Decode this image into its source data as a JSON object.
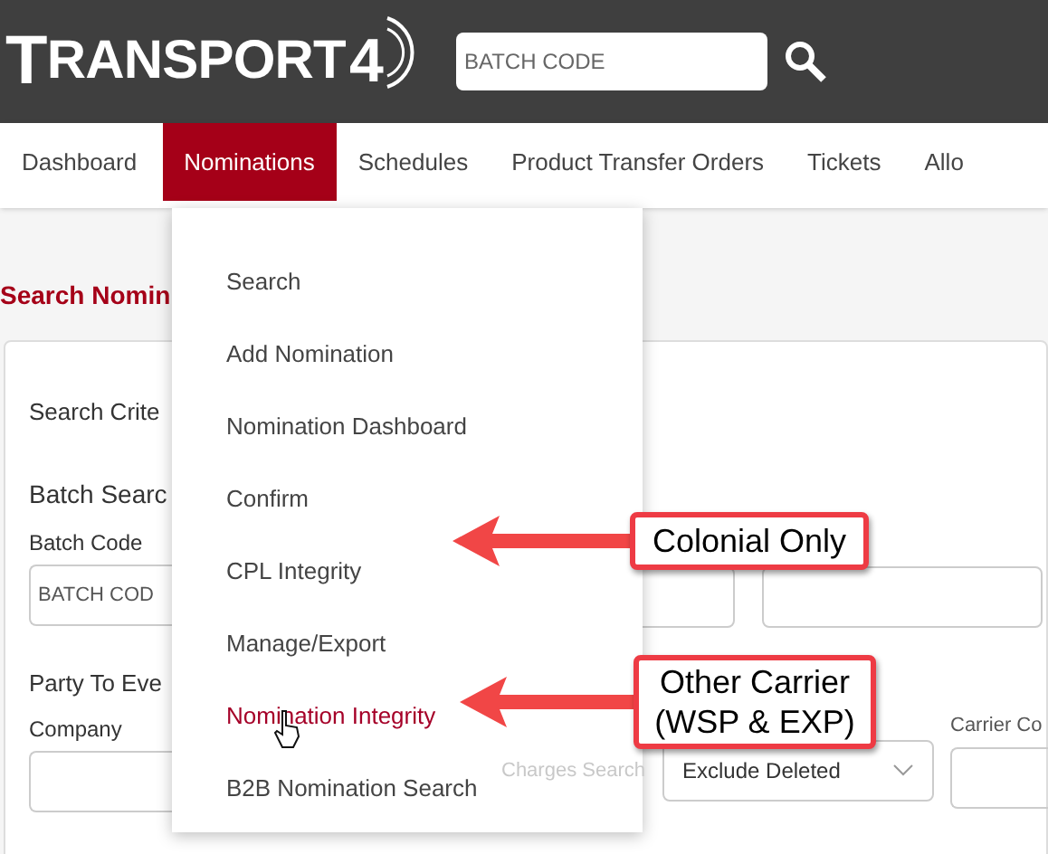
{
  "header": {
    "logo": {
      "text": "TRANSPORT",
      "digit": "4"
    },
    "search": {
      "placeholder": "BATCH CODE"
    }
  },
  "nav": [
    {
      "label": "Dashboard",
      "selected": false
    },
    {
      "label": "Nominations",
      "selected": true
    },
    {
      "label": "Schedules",
      "selected": false
    },
    {
      "label": "Product Transfer Orders",
      "selected": false
    },
    {
      "label": "Tickets",
      "selected": false
    },
    {
      "label": "Allo",
      "selected": false
    }
  ],
  "page_title": "Search Nomin",
  "form": {
    "section": "Search Crite",
    "batch_heading": "Batch Searc",
    "batch_label": "Batch Code",
    "batch_placeholder": "BATCH COD",
    "party_heading": "Party To Eve",
    "company_label": "Company",
    "status_value": "Exclude Deleted",
    "carrier_label": "Carrier Co"
  },
  "dropdown": [
    {
      "label": "Search",
      "selected": false
    },
    {
      "label": "Add Nomination",
      "selected": false
    },
    {
      "label": "Nomination Dashboard",
      "selected": false
    },
    {
      "label": "Confirm",
      "selected": false
    },
    {
      "label": "CPL Integrity",
      "selected": false
    },
    {
      "label": "Manage/Export",
      "selected": false
    },
    {
      "label": "Nomination Integrity",
      "selected": true
    },
    {
      "label": "B2B Nomination Search",
      "selected": false
    }
  ],
  "tooltip": "Charges Search",
  "callouts": [
    {
      "lines": [
        "Colonial Only"
      ]
    },
    {
      "lines": [
        "Other Carrier",
        "(WSP & EXP)"
      ]
    }
  ]
}
